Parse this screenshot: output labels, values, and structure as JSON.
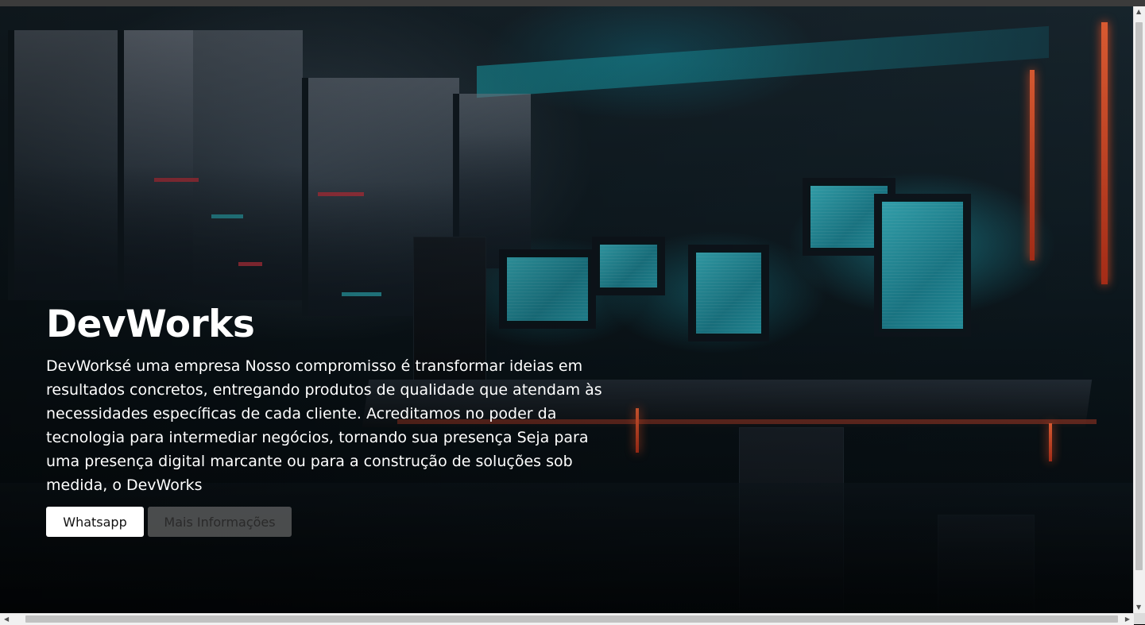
{
  "hero": {
    "title": "DevWorks",
    "description": "DevWorksé uma empresa Nosso compromisso é transformar ideias em resultados concretos, entregando produtos de qualidade que atendam às necessidades específicas de cada cliente. Acreditamos no poder da tecnologia para intermediar negócios, tornando sua presença Seja para uma presença digital marcante ou para a construção de soluções sob medida, o DevWorks",
    "buttons": {
      "primary_label": "Whatsapp",
      "secondary_label": "Mais Informações"
    },
    "background_image": "cyberpunk-office-with-monitors"
  },
  "colors": {
    "text": "#ffffff",
    "primary_button_bg": "#ffffff",
    "secondary_button_bg": "#7a7a7a",
    "accent_cyan": "#35c9d6",
    "accent_red": "#e0404e"
  },
  "scrollbars": {
    "arrow_up": "▲",
    "arrow_down": "▼",
    "arrow_left": "◀",
    "arrow_right": "▶"
  }
}
